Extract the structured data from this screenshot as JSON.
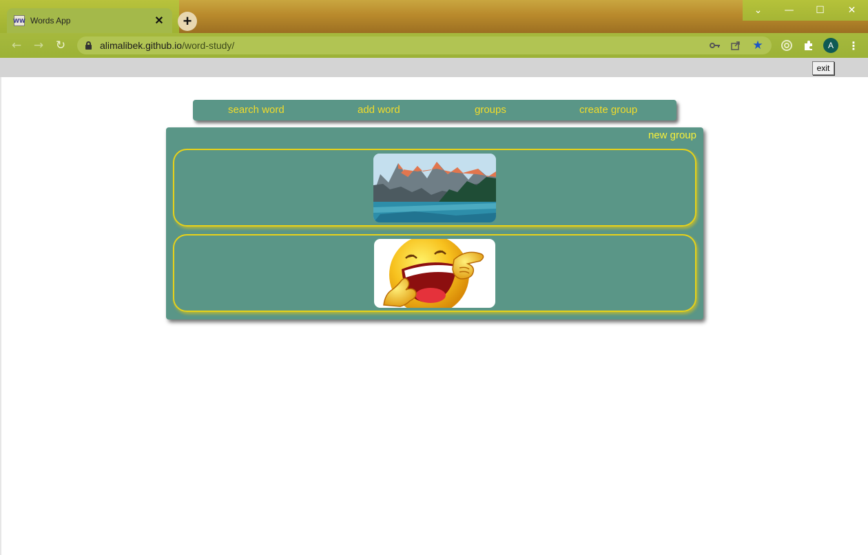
{
  "browser": {
    "tab_title": "Words App",
    "tab_close": "✕",
    "new_tab": "+",
    "url_host": "alimalibek.github.io",
    "url_path": "/word-study/",
    "profile_initial": "A",
    "window_controls": {
      "chevron": "⌄",
      "minimize": "—",
      "maximize": "☐",
      "close": "✕"
    }
  },
  "page": {
    "exit_label": "exit",
    "nav": {
      "search_word": "search word",
      "add_word": "add word",
      "groups": "groups",
      "create_group": "create group"
    },
    "new_group_label": "new group",
    "groups": [
      {
        "image": "mountain-lake-image"
      },
      {
        "image": "laughing-emoji-image"
      }
    ]
  },
  "colors": {
    "panel": "#5a9687",
    "link_text": "#f2dc2a",
    "card_border": "#e8d219",
    "browser_frame": "#a6b93d"
  }
}
